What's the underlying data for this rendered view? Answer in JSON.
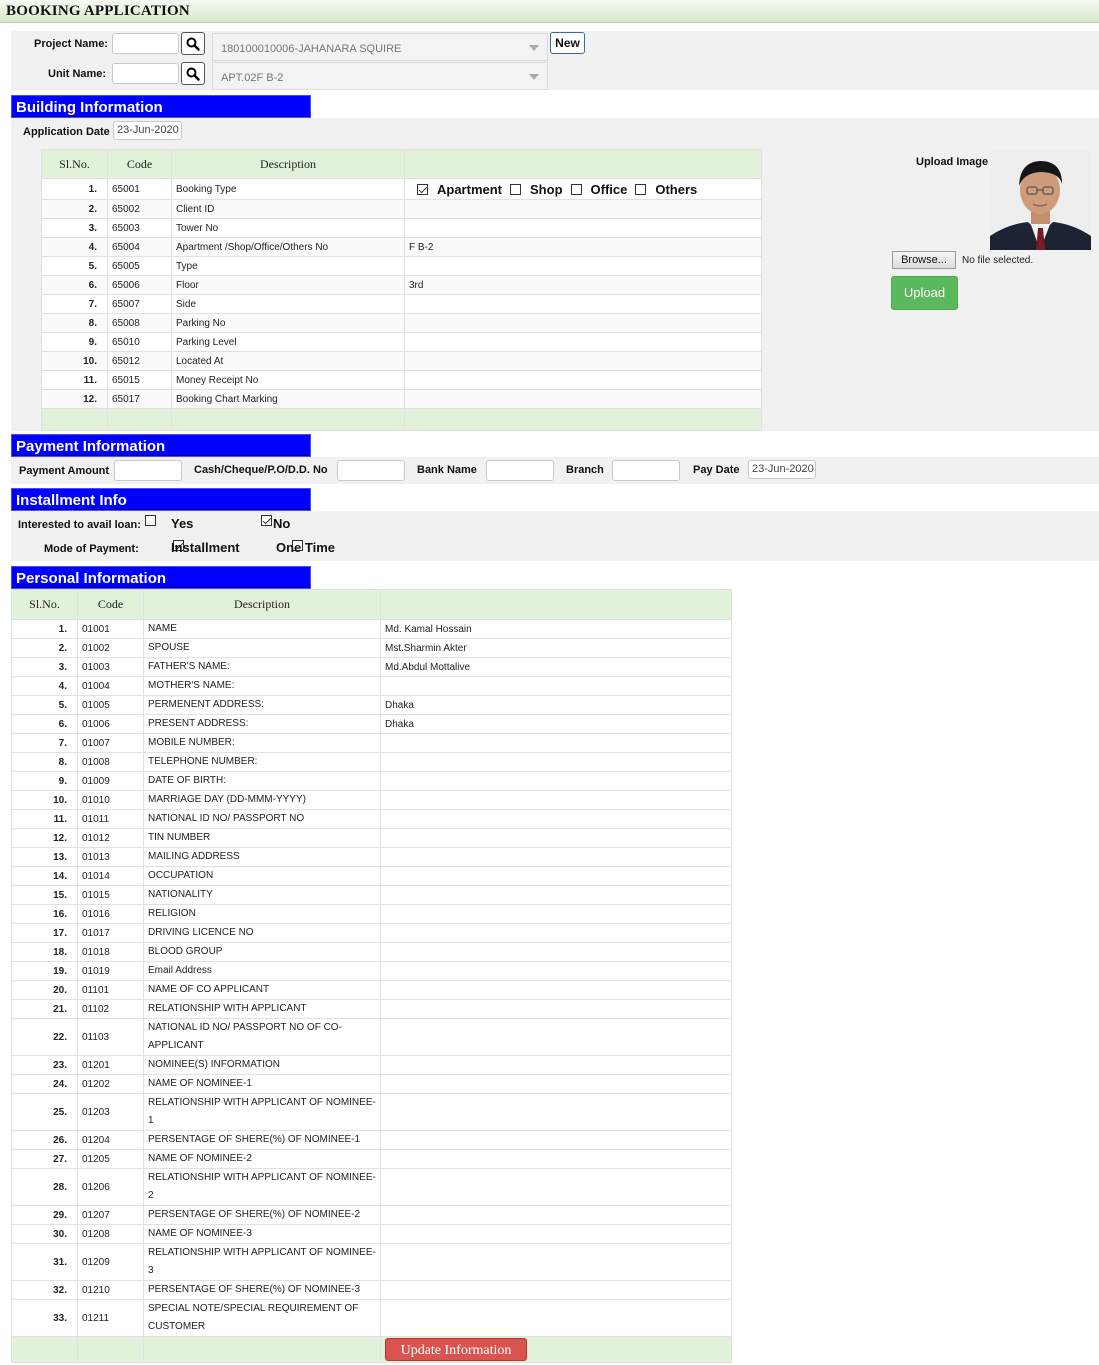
{
  "header": {
    "title": "BOOKING APPLICATION"
  },
  "project": {
    "project_label": "Project Name:",
    "project_value": "180100010006-JAHANARA SQUIRE",
    "unit_label": "Unit Name:",
    "unit_value": "APT.02F B-2",
    "new_label": "New"
  },
  "building": {
    "section_title": "Building Information",
    "app_date_label": "Application Date",
    "app_date": "23-Jun-2020",
    "headers": [
      "Sl.No.",
      "Code",
      "Description",
      ""
    ],
    "booking_options": [
      {
        "label": "Apartment",
        "checked": true
      },
      {
        "label": "Shop",
        "checked": false
      },
      {
        "label": "Office",
        "checked": false
      },
      {
        "label": "Others",
        "checked": false
      }
    ],
    "rows": [
      {
        "sl": "1.",
        "code": "65001",
        "desc": "Booking Type",
        "value": ""
      },
      {
        "sl": "2.",
        "code": "65002",
        "desc": "Client ID",
        "value": ""
      },
      {
        "sl": "3.",
        "code": "65003",
        "desc": "Tower No",
        "value": ""
      },
      {
        "sl": "4.",
        "code": "65004",
        "desc": "Apartment /Shop/Office/Others No",
        "value": "F B-2"
      },
      {
        "sl": "5.",
        "code": "65005",
        "desc": "Type",
        "value": ""
      },
      {
        "sl": "6.",
        "code": "65006",
        "desc": "Floor",
        "value": "3rd"
      },
      {
        "sl": "7.",
        "code": "65007",
        "desc": "Side",
        "value": ""
      },
      {
        "sl": "8.",
        "code": "65008",
        "desc": "Parking No",
        "value": ""
      },
      {
        "sl": "9.",
        "code": "65010",
        "desc": "Parking Level",
        "value": ""
      },
      {
        "sl": "10.",
        "code": "65012",
        "desc": "Located At",
        "value": ""
      },
      {
        "sl": "11.",
        "code": "65015",
        "desc": "Money Receipt No",
        "value": ""
      },
      {
        "sl": "12.",
        "code": "65017",
        "desc": "Booking Chart Marking",
        "value": ""
      }
    ]
  },
  "upload": {
    "label": "Upload Image",
    "browse_label": "Browse...",
    "file_status": "No file selected.",
    "upload_label": "Upload"
  },
  "payment": {
    "section_title": "Payment Information",
    "amount_label": "Payment Amount",
    "cheque_label": "Cash/Cheque/P.O/D.D. No",
    "bank_label": "Bank Name",
    "branch_label": "Branch",
    "pay_date_label": "Pay Date",
    "pay_date": "23-Jun-2020"
  },
  "installment": {
    "section_title": "Installment Info",
    "loan_label": "Interested to avail loan:",
    "loan_yes": "Yes",
    "loan_no": "No",
    "loan_yes_checked": false,
    "loan_no_checked": true,
    "mode_label": "Mode of Payment:",
    "mode_installment": "Installment",
    "mode_onetime": "One Time",
    "mode_installment_checked": true,
    "mode_onetime_checked": false
  },
  "personal": {
    "section_title": "Personal Information",
    "headers": [
      "Sl.No.",
      "Code",
      "Description",
      ""
    ],
    "update_label": "Update Information",
    "rows": [
      {
        "sl": "1.",
        "code": "01001",
        "desc": "NAME",
        "value": "Md. Kamal Hossain"
      },
      {
        "sl": "2.",
        "code": "01002",
        "desc": "SPOUSE",
        "value": "Mst.Sharmin Akter"
      },
      {
        "sl": "3.",
        "code": "01003",
        "desc": "FATHER'S NAME:",
        "value": "Md.Abdul Mottalive"
      },
      {
        "sl": "4.",
        "code": "01004",
        "desc": "MOTHER'S NAME:",
        "value": ""
      },
      {
        "sl": "5.",
        "code": "01005",
        "desc": "PERMENENT ADDRESS:",
        "value": "Dhaka"
      },
      {
        "sl": "6.",
        "code": "01006",
        "desc": "PRESENT ADDRESS:",
        "value": "Dhaka"
      },
      {
        "sl": "7.",
        "code": "01007",
        "desc": "MOBILE NUMBER:",
        "value": ""
      },
      {
        "sl": "8.",
        "code": "01008",
        "desc": "TELEPHONE NUMBER:",
        "value": ""
      },
      {
        "sl": "9.",
        "code": "01009",
        "desc": "DATE OF BIRTH:",
        "value": ""
      },
      {
        "sl": "10.",
        "code": "01010",
        "desc": "MARRIAGE DAY (DD-MMM-YYYY)",
        "value": ""
      },
      {
        "sl": "11.",
        "code": "01011",
        "desc": "NATIONAL ID NO/ PASSPORT NO",
        "value": ""
      },
      {
        "sl": "12.",
        "code": "01012",
        "desc": "TIN NUMBER",
        "value": ""
      },
      {
        "sl": "13.",
        "code": "01013",
        "desc": "MAILING ADDRESS",
        "value": ""
      },
      {
        "sl": "14.",
        "code": "01014",
        "desc": "OCCUPATION",
        "value": ""
      },
      {
        "sl": "15.",
        "code": "01015",
        "desc": "NATIONALITY",
        "value": ""
      },
      {
        "sl": "16.",
        "code": "01016",
        "desc": "RELIGION",
        "value": ""
      },
      {
        "sl": "17.",
        "code": "01017",
        "desc": "DRIVING LICENCE NO",
        "value": ""
      },
      {
        "sl": "18.",
        "code": "01018",
        "desc": "BLOOD GROUP",
        "value": ""
      },
      {
        "sl": "19.",
        "code": "01019",
        "desc": "Email Address",
        "value": ""
      },
      {
        "sl": "20.",
        "code": "01101",
        "desc": "NAME OF CO APPLICANT",
        "value": ""
      },
      {
        "sl": "21.",
        "code": "01102",
        "desc": "RELATIONSHIP WITH APPLICANT",
        "value": ""
      },
      {
        "sl": "22.",
        "code": "01103",
        "desc": "NATIONAL ID NO/ PASSPORT NO OF CO-APPLICANT",
        "value": ""
      },
      {
        "sl": "23.",
        "code": "01201",
        "desc": "NOMINEE(S) INFORMATION",
        "value": ""
      },
      {
        "sl": "24.",
        "code": "01202",
        "desc": "NAME OF NOMINEE-1",
        "value": ""
      },
      {
        "sl": "25.",
        "code": "01203",
        "desc": "RELATIONSHIP WITH APPLICANT OF NOMINEE-1",
        "value": ""
      },
      {
        "sl": "26.",
        "code": "01204",
        "desc": "PERSENTAGE OF SHERE(%) OF NOMINEE-1",
        "value": ""
      },
      {
        "sl": "27.",
        "code": "01205",
        "desc": "NAME OF NOMINEE-2",
        "value": ""
      },
      {
        "sl": "28.",
        "code": "01206",
        "desc": "RELATIONSHIP WITH APPLICANT OF NOMINEE-2",
        "value": ""
      },
      {
        "sl": "29.",
        "code": "01207",
        "desc": "PERSENTAGE OF SHERE(%) OF NOMINEE-2",
        "value": ""
      },
      {
        "sl": "30.",
        "code": "01208",
        "desc": "NAME OF NOMINEE-3",
        "value": ""
      },
      {
        "sl": "31.",
        "code": "01209",
        "desc": "RELATIONSHIP WITH APPLICANT OF NOMINEE-3",
        "value": ""
      },
      {
        "sl": "32.",
        "code": "01210",
        "desc": "PERSENTAGE OF SHERE(%) OF NOMINEE-3",
        "value": ""
      },
      {
        "sl": "33.",
        "code": "01211",
        "desc": "SPECIAL NOTE/SPECIAL REQUIREMENT OF CUSTOMER",
        "value": ""
      }
    ]
  }
}
